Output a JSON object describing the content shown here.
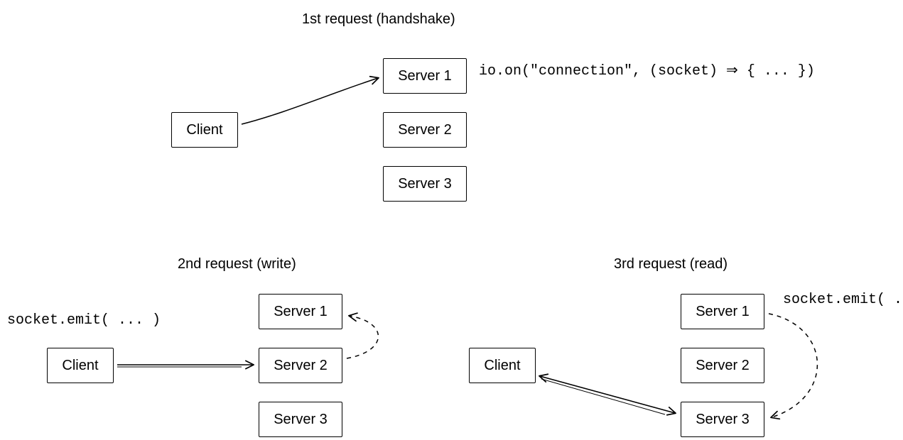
{
  "scene1": {
    "title": "1st request (handshake)",
    "client": "Client",
    "servers": [
      "Server 1",
      "Server 2",
      "Server 3"
    ],
    "code": "io.on(\"connection\", (socket) ⇒ { ... })"
  },
  "scene2": {
    "title": "2nd request (write)",
    "client": "Client",
    "servers": [
      "Server 1",
      "Server 2",
      "Server 3"
    ],
    "code": "socket.emit( ... )"
  },
  "scene3": {
    "title": "3rd request (read)",
    "client": "Client",
    "servers": [
      "Server 1",
      "Server 2",
      "Server 3"
    ],
    "code": "socket.emit( ... )"
  }
}
